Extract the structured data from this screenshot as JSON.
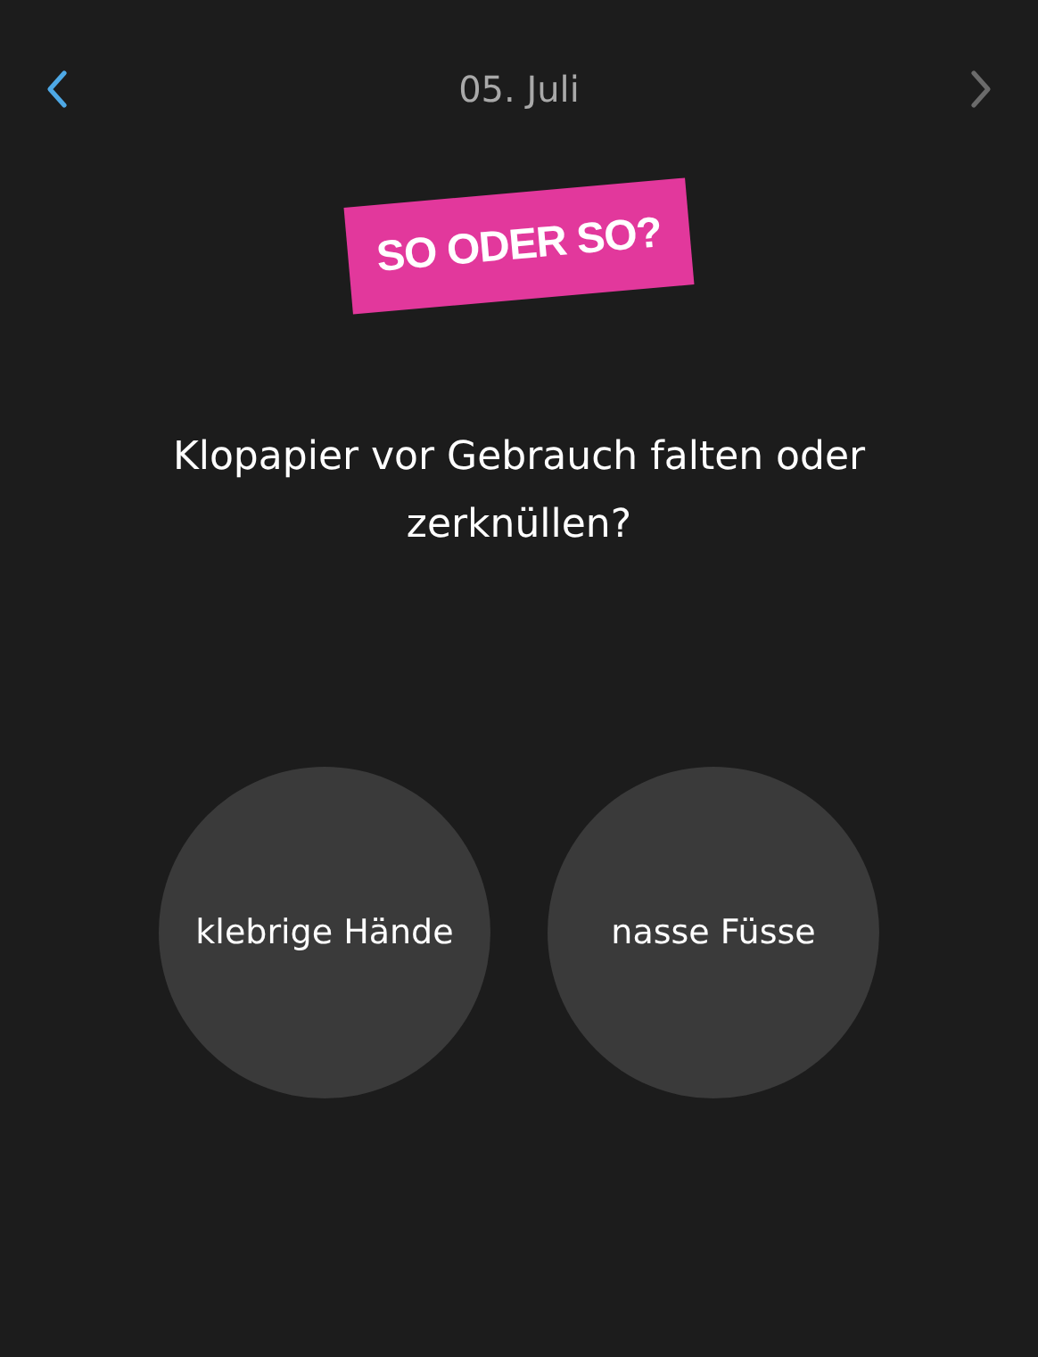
{
  "header": {
    "title": "05. Juli",
    "prev": {
      "disabled": false
    },
    "next": {
      "disabled": true
    }
  },
  "badge": "SO ODER SO?",
  "question": "Klopapier vor Gebrauch falten oder zerknüllen?",
  "options": [
    {
      "label": "klebrige Hände",
      "selected": false
    },
    {
      "label": "nasse Füsse",
      "selected": false
    }
  ]
}
